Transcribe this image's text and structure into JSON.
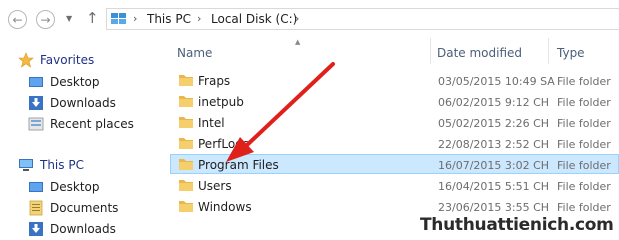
{
  "address_bar": {
    "crumbs": [
      "This PC",
      "Local Disk (C:)"
    ]
  },
  "nav_pane": {
    "favorites": {
      "label": "Favorites",
      "items": [
        {
          "label": "Desktop",
          "icon": "desktop-icon"
        },
        {
          "label": "Downloads",
          "icon": "downloads-icon"
        },
        {
          "label": "Recent places",
          "icon": "recent-places-icon"
        }
      ]
    },
    "this_pc": {
      "label": "This PC",
      "items": [
        {
          "label": "Desktop",
          "icon": "desktop-icon"
        },
        {
          "label": "Documents",
          "icon": "documents-icon"
        },
        {
          "label": "Downloads",
          "icon": "downloads-icon"
        }
      ]
    }
  },
  "columns": {
    "name": "Name",
    "date_modified": "Date modified",
    "type": "Type"
  },
  "files": [
    {
      "name": "Fraps",
      "date": "03/05/2015 10:49 SA",
      "type": "File folder",
      "selected": false
    },
    {
      "name": "inetpub",
      "date": "06/02/2015 9:12 CH",
      "type": "File folder",
      "selected": false
    },
    {
      "name": "Intel",
      "date": "05/02/2015 2:26 CH",
      "type": "File folder",
      "selected": false
    },
    {
      "name": "PerfLogs",
      "date": "22/08/2013 2:52 CH",
      "type": "File folder",
      "selected": false
    },
    {
      "name": "Program Files",
      "date": "16/07/2015 3:02 CH",
      "type": "File folder",
      "selected": true
    },
    {
      "name": "Users",
      "date": "16/04/2015 5:51 CH",
      "type": "File folder",
      "selected": false
    },
    {
      "name": "Windows",
      "date": "23/06/2015 3:55 CH",
      "type": "File folder",
      "selected": false
    }
  ],
  "watermark": "Thuthuattienich.com",
  "colors": {
    "selection_fill": "#cce8ff",
    "selection_border": "#99d1ff",
    "annotation_arrow": "#e0201b",
    "folder_yellow": "#f5cf6b"
  }
}
